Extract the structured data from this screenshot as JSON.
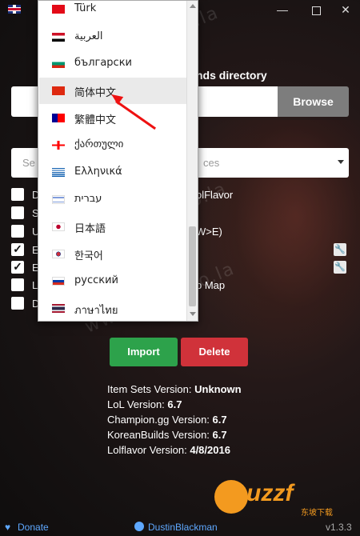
{
  "window": {
    "minimize_glyph": "—",
    "close_glyph": "✕"
  },
  "form": {
    "directory_label": "nds directory",
    "browse_label": "Browse",
    "select_placeholder_left": "Se",
    "select_placeholder_right": "ces",
    "select_value": ""
  },
  "options": [
    {
      "label": "D",
      "checked": false,
      "extra": "olFlavor"
    },
    {
      "label": "S",
      "checked": false,
      "extra": ""
    },
    {
      "label": "U",
      "checked": false,
      "extra": "W>E)"
    },
    {
      "label": "E",
      "checked": true,
      "extra": ""
    },
    {
      "label": "E",
      "checked": true,
      "extra": ""
    },
    {
      "label": "Li",
      "checked": false,
      "extra": "p Map"
    },
    {
      "label": "D",
      "checked": false,
      "extra": ""
    }
  ],
  "checkmark_glyph": "✓",
  "wrench_glyph": "🔧",
  "actions": {
    "import_label": "Import",
    "delete_label": "Delete"
  },
  "info": [
    {
      "label": "Item Sets Version: ",
      "value": "Unknown"
    },
    {
      "label": "LoL Version: ",
      "value": "6.7"
    },
    {
      "label": "Champion.gg Version: ",
      "value": "6.7"
    },
    {
      "label": "KoreanBuilds Version: ",
      "value": "6.7"
    },
    {
      "label": "Lolflavor Version: ",
      "value": "4/8/2016"
    }
  ],
  "footer": {
    "heart_glyph": "♥",
    "donate_label": "Donate",
    "github_user": "DustinBlackman",
    "version": "v1.3.3"
  },
  "language_dropdown": {
    "selected": "简体中文",
    "items": [
      {
        "label": "Türk",
        "flag": "turkey"
      },
      {
        "label": "العربية",
        "flag": "egypt"
      },
      {
        "label": "български",
        "flag": "bulgaria"
      },
      {
        "label": "简体中文",
        "flag": "china"
      },
      {
        "label": "繁體中文",
        "flag": "taiwan"
      },
      {
        "label": "ქართული",
        "flag": "georgia"
      },
      {
        "label": "Ελληνικά",
        "flag": "greece"
      },
      {
        "label": "עברית",
        "flag": "israel"
      },
      {
        "label": "日本語",
        "flag": "japan"
      },
      {
        "label": "한국어",
        "flag": "korea"
      },
      {
        "label": "русский",
        "flag": "russia"
      },
      {
        "label": "ภาษาไทย",
        "flag": "thailand"
      }
    ]
  },
  "watermark": {
    "text": "www.xiaodao.la",
    "logo_text": "uzzf",
    "logo_sub": "东坡下载"
  },
  "colors": {
    "import": "#2da24b",
    "delete": "#d0323a",
    "link": "#5ea8ff",
    "annotation_arrow": "#e11111"
  }
}
